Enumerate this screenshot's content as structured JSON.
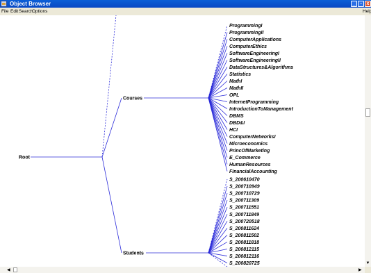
{
  "window": {
    "title": "Object Browser",
    "controls": [
      "_",
      "▫",
      "x"
    ]
  },
  "menus": {
    "file": "File",
    "edit": "Edit",
    "search": "Search",
    "options": "Options",
    "help": "Help"
  },
  "tree": {
    "root": "Root",
    "courses": {
      "label": "Courses",
      "items": [
        "ProgrammingI",
        "ProgrammingII",
        "ComputerApplications",
        "ComputerEthics",
        "SoftwareEngineeringI",
        "SoftwareEngineeringII",
        "DataStructures&Algorithms",
        "Statistics",
        "MathI",
        "MathII",
        "OPL",
        "InternetProgramming",
        "IntroductionToManagement",
        "DBMS",
        "DBD&I",
        "HCI",
        "ComputerNetworksI",
        "Microeconomics",
        "PrincOfMarketing",
        "E_Commerce",
        "HumanResources",
        "FinancialAccounting"
      ]
    },
    "students": {
      "label": "Students",
      "items": [
        "S_200610470",
        "S_200710949",
        "S_200710729",
        "S_200711309",
        "S_200711551",
        "S_200711849",
        "S_200720518",
        "S_200811624",
        "S_200811502",
        "S_200811818",
        "S_200812115",
        "S_200812116",
        "S_200820725"
      ]
    }
  },
  "colors": {
    "edge": "#2b2bd9",
    "titlebar": "#0a5ed6",
    "menubar": "#ece9d8"
  }
}
